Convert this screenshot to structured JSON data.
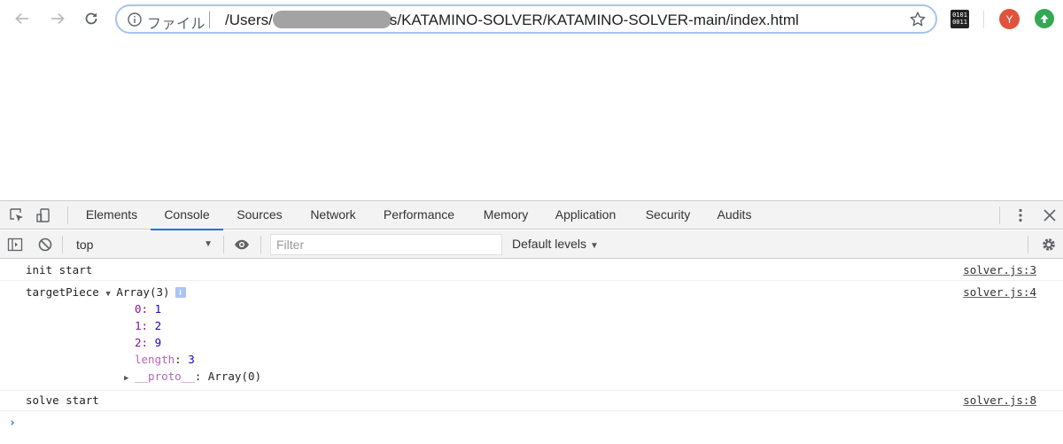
{
  "browser": {
    "omnibox": {
      "scheme_label": "ファイル",
      "url_prefix": "/Users/",
      "url_suffix": "s/KATAMINO-SOLVER/KATAMINO-SOLVER-main/index.html"
    },
    "extension_label": "0101 0011",
    "avatar_initial": "Y"
  },
  "devtools": {
    "tabs": [
      "Elements",
      "Console",
      "Sources",
      "Network",
      "Performance",
      "Memory",
      "Application",
      "Security",
      "Audits"
    ],
    "active_tab": "Console",
    "context": "top",
    "filter_placeholder": "Filter",
    "levels_label": "Default levels"
  },
  "console": {
    "messages": [
      {
        "text": "init start",
        "source": "solver.js:3"
      },
      {
        "label": "targetPiece",
        "summary": "Array(3)",
        "source": "solver.js:4",
        "props": [
          {
            "key": "0",
            "value": "1"
          },
          {
            "key": "1",
            "value": "2"
          },
          {
            "key": "2",
            "value": "9"
          },
          {
            "key": "length",
            "value": "3"
          },
          {
            "key": "__proto__",
            "value": "Array(0)"
          }
        ]
      },
      {
        "text": "solve start",
        "source": "solver.js:8"
      }
    ]
  },
  "colors": {
    "accent": "#1a73e8",
    "number": "#1c00cf",
    "property_key": "#881391",
    "avatar": "#e0533a",
    "update": "#34a853"
  }
}
